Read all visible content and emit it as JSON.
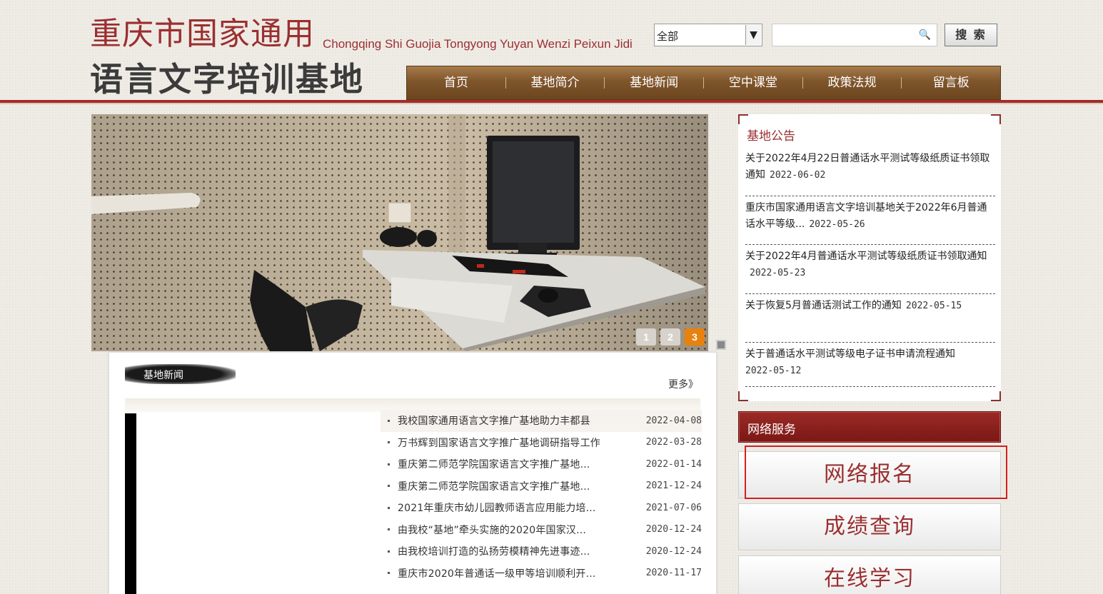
{
  "header": {
    "logo_line1": "重庆市国家通用",
    "logo_pinyin": "Chongqing Shi Guojia Tongyong Yuyan Wenzi Peixun Jidi",
    "logo_line2": "语言文字培训基地"
  },
  "search": {
    "scope_value": "全部",
    "input_value": "",
    "button_label": "搜 索"
  },
  "nav": {
    "items": [
      {
        "label": "首页"
      },
      {
        "label": "基地简介"
      },
      {
        "label": "基地新闻"
      },
      {
        "label": "空中课堂"
      },
      {
        "label": "政策法规"
      },
      {
        "label": "留言板"
      }
    ]
  },
  "slideshow": {
    "pages": [
      "1",
      "2",
      "3"
    ],
    "active_page": "3"
  },
  "news": {
    "title": "基地新闻",
    "more_label": "更多》",
    "items": [
      {
        "text": "我校国家通用语言文字推广基地助力丰都县",
        "date": "2022-04-08"
      },
      {
        "text": "万书辉到国家语言文字推广基地调研指导工作",
        "date": "2022-03-28"
      },
      {
        "text": "重庆第二师范学院国家语言文字推广基地...",
        "date": "2022-01-14"
      },
      {
        "text": "重庆第二师范学院国家语言文字推广基地...",
        "date": "2021-12-24"
      },
      {
        "text": "2021年重庆市幼儿园教师语言应用能力培...",
        "date": "2021-07-06"
      },
      {
        "text": "由我校“基地”牵头实施的2020年国家汉...",
        "date": "2020-12-24"
      },
      {
        "text": "由我校培训打造的弘扬劳模精神先进事迹...",
        "date": "2020-12-24"
      },
      {
        "text": "重庆市2020年普通话一级甲等培训顺利开...",
        "date": "2020-11-17"
      }
    ]
  },
  "notice": {
    "title": "基地公告",
    "items": [
      {
        "text": "关于2022年4月22日普通话水平测试等级纸质证书领取通知",
        "date": "2022-06-02"
      },
      {
        "text": "重庆市国家通用语言文字培训基地关于2022年6月普通话水平等级...",
        "date": "2022-05-26"
      },
      {
        "text": "关于2022年4月普通话水平测试等级纸质证书领取通知",
        "date": "2022-05-23"
      },
      {
        "text": "关于恢复5月普通话测试工作的通知",
        "date": "2022-05-15"
      },
      {
        "text": "关于普通话水平测试等级电子证书申请流程通知",
        "date": "2022-05-12"
      }
    ]
  },
  "services": {
    "title": "网络服务",
    "buttons": [
      {
        "label": "网络报名"
      },
      {
        "label": "成绩查询"
      },
      {
        "label": "在线学习"
      }
    ]
  },
  "colors": {
    "brand_red": "#9b2f30",
    "nav_brown": "#7f552b",
    "slide_active": "#e8820e",
    "highlight_red": "#d31f1f"
  }
}
